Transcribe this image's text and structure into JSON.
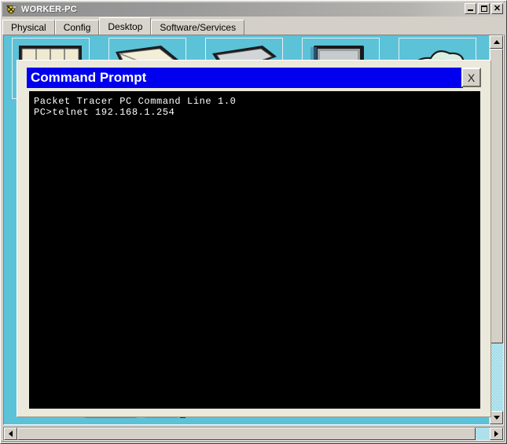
{
  "window": {
    "title": "WORKER-PC",
    "icon": "packet-tracer-device-icon",
    "buttons": {
      "minimize": "_",
      "maximize": "□",
      "close": "✕"
    }
  },
  "tabs": [
    {
      "label": "Physical",
      "active": false
    },
    {
      "label": "Config",
      "active": false
    },
    {
      "label": "Desktop",
      "active": true
    },
    {
      "label": "Software/Services",
      "active": false
    }
  ],
  "desktop": {
    "background_color": "#5bc2d8",
    "icons": [
      {
        "name": "ip-configuration-icon"
      },
      {
        "name": "dial-up-icon"
      },
      {
        "name": "terminal-icon"
      },
      {
        "name": "command-prompt-icon"
      },
      {
        "name": "web-browser-icon"
      }
    ]
  },
  "command_prompt": {
    "title": "Command Prompt",
    "close_label": "X",
    "terminal": {
      "background_color": "#000000",
      "text_color": "#ffffff",
      "lines": [
        "Packet Tracer PC Command Line 1.0",
        "PC>telnet 192.168.1.254"
      ]
    }
  },
  "scrollbars": {
    "vertical": {
      "up_arrow": "▲",
      "down_arrow": "▼"
    },
    "horizontal": {
      "left_arrow": "◀",
      "right_arrow": "▶"
    }
  }
}
